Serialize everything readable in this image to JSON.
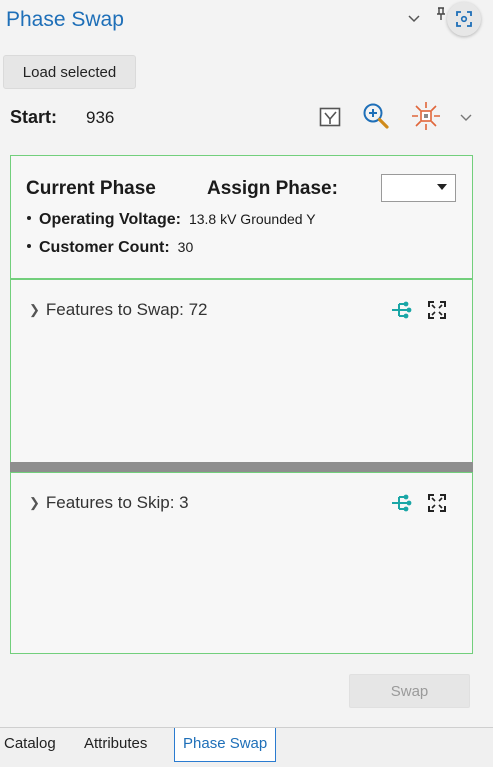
{
  "window": {
    "title": "Phase Swap",
    "pin_glyph": "1",
    "chevron_glyph": "⌄"
  },
  "toolbar": {
    "load_selected_label": "Load selected"
  },
  "start": {
    "label": "Start:",
    "value": "936"
  },
  "phase": {
    "current_label": "Current Phase",
    "assign_label": "Assign Phase:",
    "assign_value": ""
  },
  "details": {
    "voltage_label": "Operating Voltage:",
    "voltage_value": "13.8 kV Grounded Y",
    "customer_label": "Customer Count:",
    "customer_value": "30"
  },
  "features_swap": {
    "label": "Features to Swap: 72"
  },
  "features_skip": {
    "label": "Features to Skip:  3"
  },
  "actions": {
    "swap_label": "Swap"
  },
  "tabs": [
    {
      "label": "Catalog",
      "active": false
    },
    {
      "label": "Attributes",
      "active": false
    },
    {
      "label": "Phase Swap",
      "active": true
    }
  ],
  "colors": {
    "accent": "#1e6fb8",
    "panel_border": "#72cf7c",
    "network_icon": "#1aa6a6",
    "flash_icon": "#e0663a"
  }
}
